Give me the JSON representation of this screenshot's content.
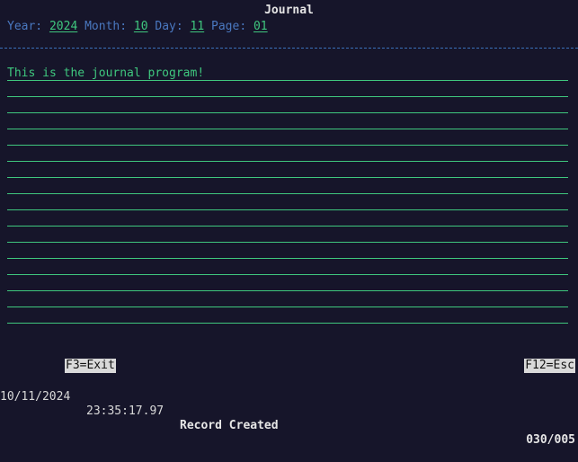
{
  "window": {
    "title": "Journal"
  },
  "header": {
    "year_label": "Year:",
    "year_value": "2024",
    "month_label": "Month:",
    "month_value": "10",
    "day_label": "Day:",
    "day_value": "11",
    "page_label": "Page:",
    "page_value": "01"
  },
  "entry": {
    "lines": [
      "This is the journal program!",
      "",
      "",
      "",
      "",
      "",
      "",
      "",
      "",
      "",
      "",
      "",
      "",
      "",
      "",
      "",
      ""
    ]
  },
  "function_keys": {
    "exit_label": "F3=Exit",
    "esc_label": "F12=Esc"
  },
  "status": {
    "date": "10/11/2024",
    "time": "23:35:17.97",
    "message": "Record Created",
    "counter": "030/005"
  },
  "colors": {
    "background": "#16152a",
    "field": "#3fc77e",
    "label": "#4a78c0",
    "function_key_bg": "#d9d9d9"
  }
}
